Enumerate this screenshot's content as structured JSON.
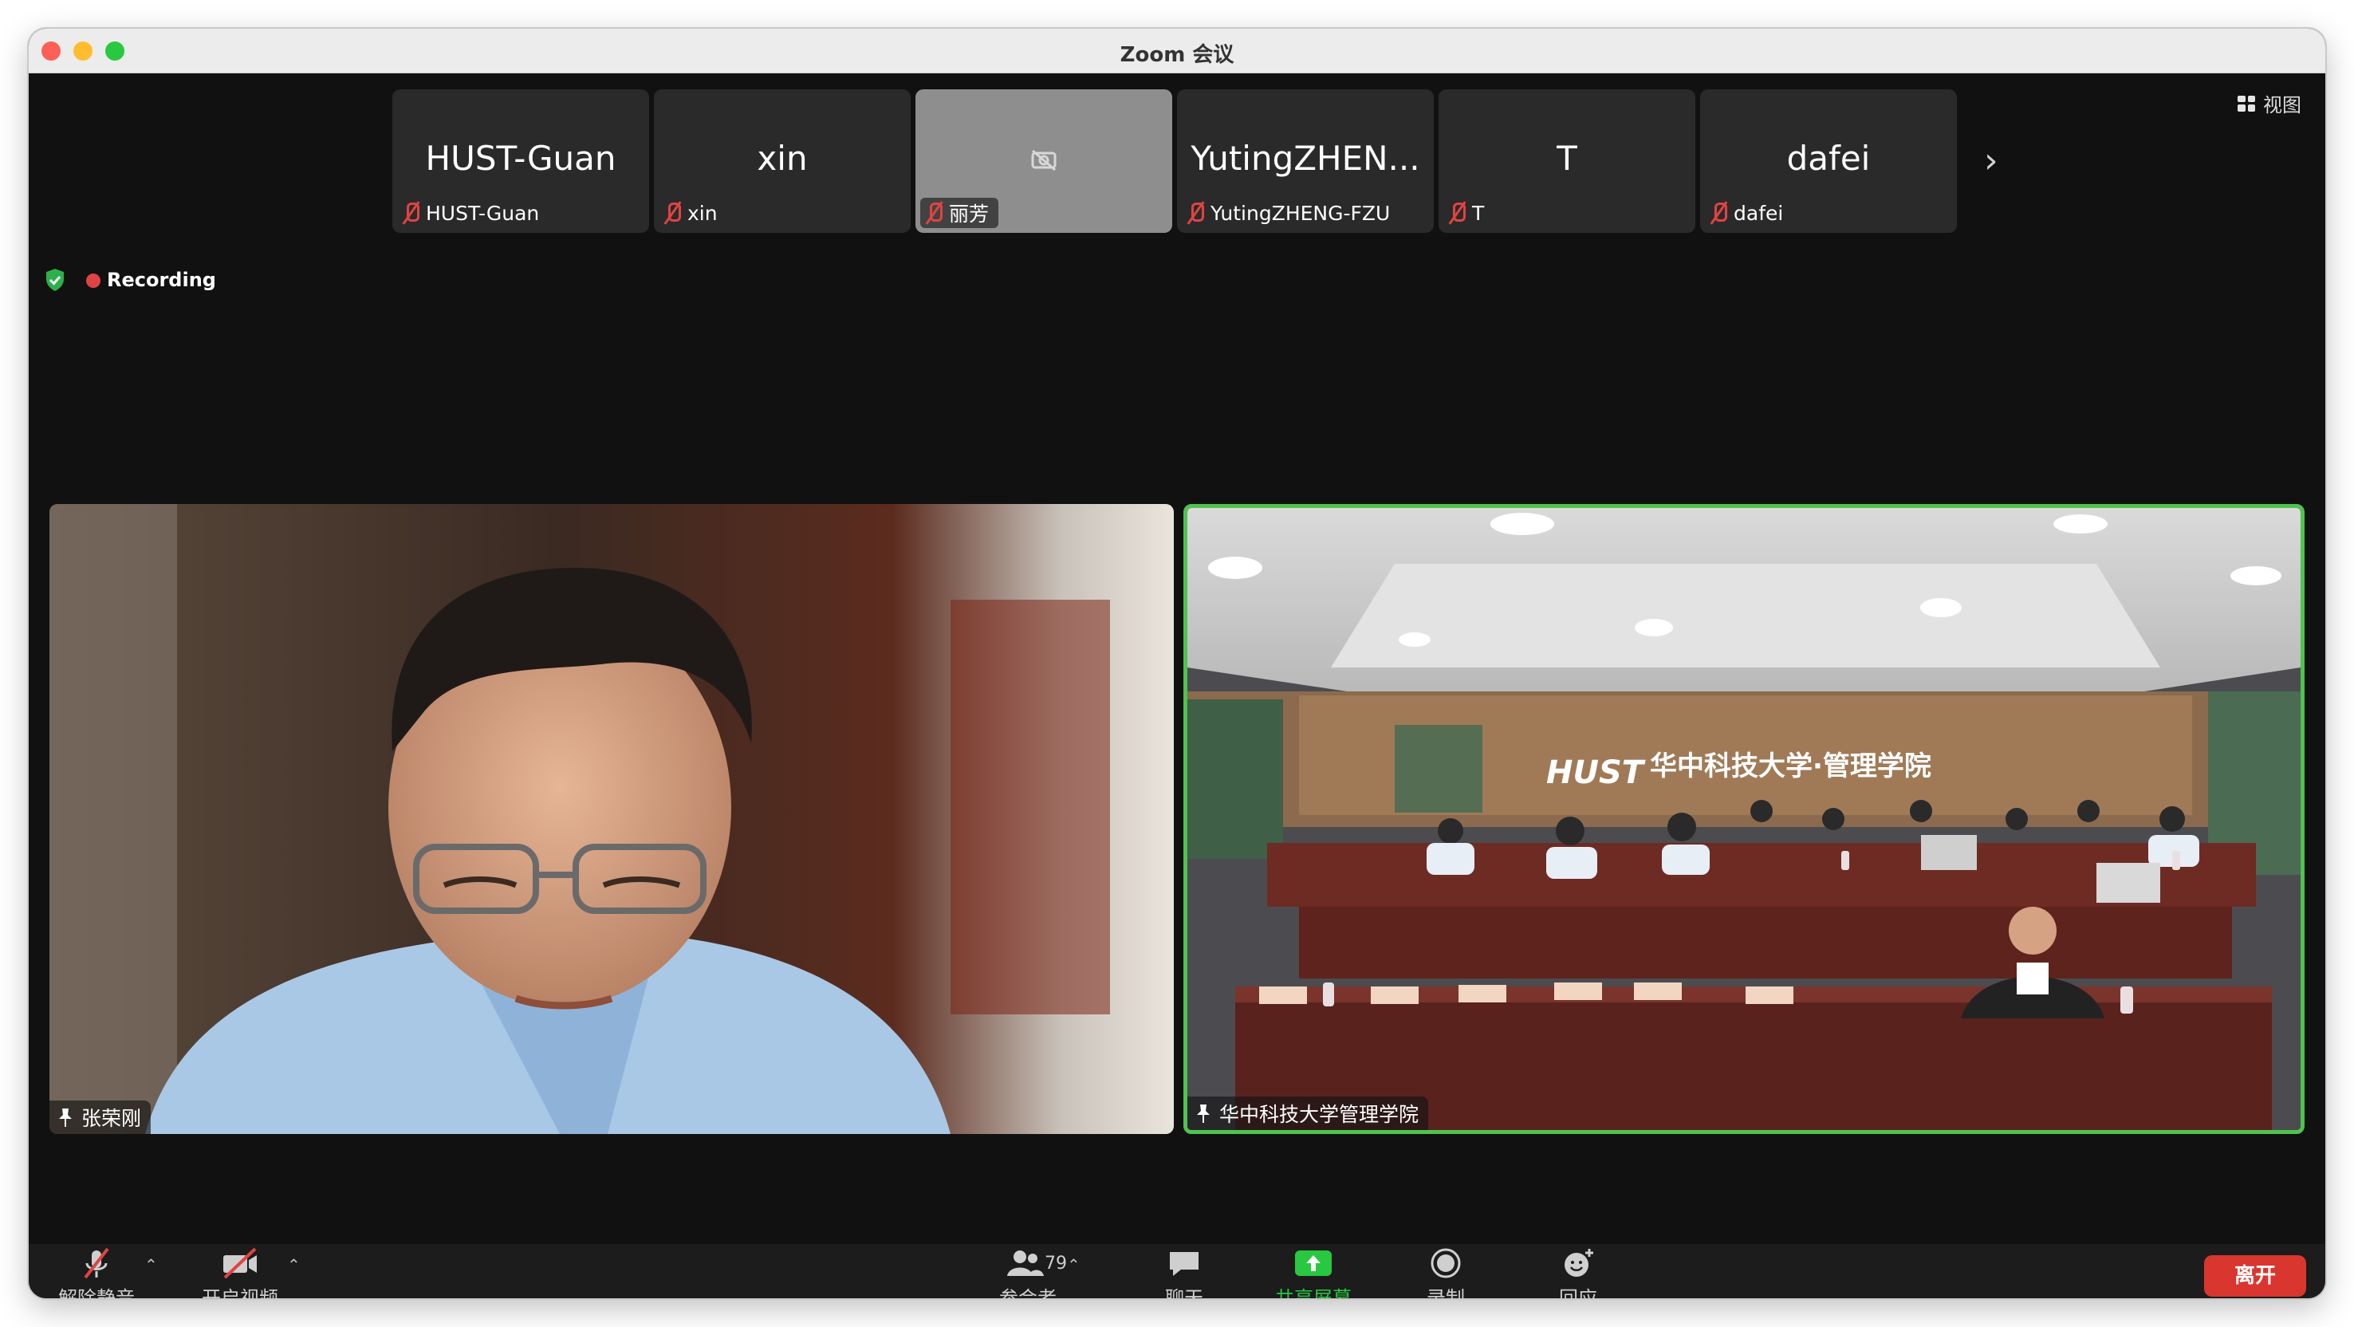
{
  "window": {
    "title": "Zoom 会议"
  },
  "view_button": {
    "label": "视图"
  },
  "participants": [
    {
      "display": "HUST-Guan",
      "label": "HUST-Guan"
    },
    {
      "display": "xin",
      "label": "xin"
    },
    {
      "display": "",
      "label": "丽芳"
    },
    {
      "display": "YutingZHEN...",
      "label": "YutingZHENG-FZU"
    },
    {
      "display": "T",
      "label": "T"
    },
    {
      "display": "dafei",
      "label": "dafei"
    }
  ],
  "recording": {
    "label": "Recording"
  },
  "main_videos": {
    "left_label": "张荣刚",
    "right_label": "华中科技大学管理学院",
    "banner_text": "华中科技大学·管理学院"
  },
  "toolbar": {
    "unmute": "解除静音",
    "start_video": "开启视频",
    "participants": "参会者",
    "participant_count": "79",
    "chat": "聊天",
    "share": "共享屏幕",
    "record": "录制",
    "reactions": "回应",
    "leave": "离开"
  },
  "colors": {
    "active_speaker": "#4fc34f",
    "leave": "#d9362f",
    "share": "#28c840",
    "muted": "#e04343"
  }
}
